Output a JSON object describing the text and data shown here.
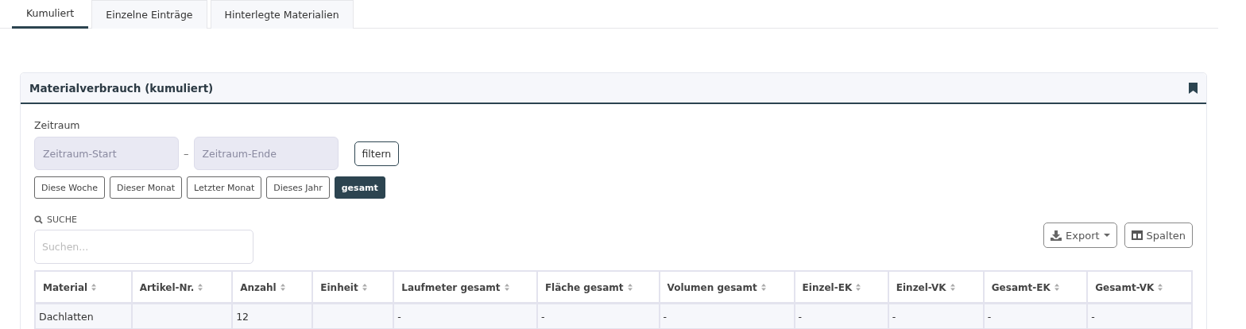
{
  "tabs": [
    {
      "label": "Kumuliert",
      "selected": true
    },
    {
      "label": "Einzelne Einträge",
      "selected": false
    },
    {
      "label": "Hinterlegte Materialien",
      "selected": false
    }
  ],
  "card": {
    "title": "Materialverbrauch (kumuliert)",
    "period": {
      "label": "Zeitraum",
      "start": {
        "placeholder": "Zeitraum-Start"
      },
      "separator": "–",
      "end": {
        "placeholder": "Zeitraum-Ende"
      },
      "filter_button": "filtern"
    },
    "presets": [
      {
        "label": "Diese Woche",
        "selected": false
      },
      {
        "label": "Dieser Monat",
        "selected": false
      },
      {
        "label": "Letzter Monat",
        "selected": false
      },
      {
        "label": "Dieses Jahr",
        "selected": false
      },
      {
        "label": "gesamt",
        "selected": true
      }
    ],
    "search": {
      "label": "SUCHE",
      "placeholder": "Suchen..."
    },
    "export_button": "Export",
    "columns_button": "Spalten",
    "table": {
      "columns": [
        {
          "label": "Material"
        },
        {
          "label": "Artikel-Nr."
        },
        {
          "label": "Anzahl"
        },
        {
          "label": "Einheit"
        },
        {
          "label": "Laufmeter gesamt"
        },
        {
          "label": "Fläche gesamt"
        },
        {
          "label": "Volumen gesamt"
        },
        {
          "label": "Einzel-EK"
        },
        {
          "label": "Einzel-VK"
        },
        {
          "label": "Gesamt-EK"
        },
        {
          "label": "Gesamt-VK"
        }
      ],
      "rows": [
        [
          "Dachlatten",
          null,
          "12",
          null,
          "-",
          "-",
          "-",
          "-",
          "-",
          "-",
          "-"
        ]
      ]
    }
  }
}
